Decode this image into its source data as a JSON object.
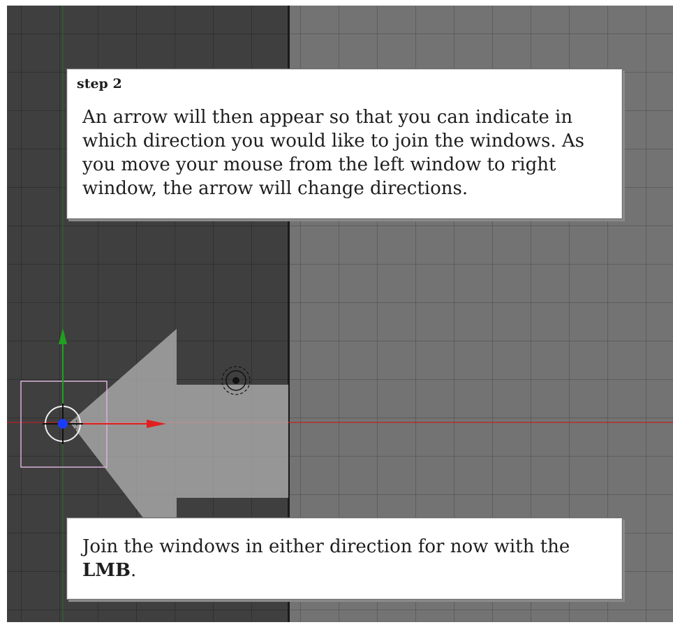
{
  "step_callout": {
    "label": "step 2",
    "text": "An arrow will then appear so that you can indicate in which direction you would like to join the windows. As you move your mouse from the left window to right window, the arrow will change directions."
  },
  "join_callout": {
    "text_before": "Join the windows in either direction for now with the ",
    "text_bold": "LMB",
    "text_after": "."
  },
  "colors": {
    "left_window_bg": "#3f3f3f",
    "right_window_bg": "#737373",
    "join_arrow": "#a6a6a6",
    "x_axis": "#e02020",
    "y_axis": "#20a020",
    "selection_box": "#d8b0d8",
    "object_origin": "#1a3cff"
  },
  "icons": [
    "join-direction-arrow",
    "object-origin-icon",
    "lamp-icon",
    "x-axis-arrow",
    "y-axis-arrow"
  ]
}
